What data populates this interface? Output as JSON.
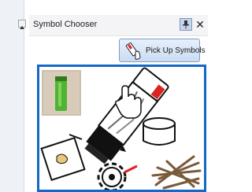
{
  "panel": {
    "title": "Symbol Chooser",
    "pin_glyph": "📌",
    "close_glyph": "✕",
    "pickup_button_label": "Pick Up Symbols",
    "pickup_icon": "glue-stick-hand-icon"
  },
  "collapse_button": {
    "icon": "collapse-arrow-icon"
  },
  "symbol_picture": {
    "icons": [
      "glue-stick-photo",
      "glue-stick-icon",
      "hand-cursor-icon",
      "paper-icon",
      "gear-icon",
      "bowl-icon",
      "sticks-icon"
    ]
  }
}
